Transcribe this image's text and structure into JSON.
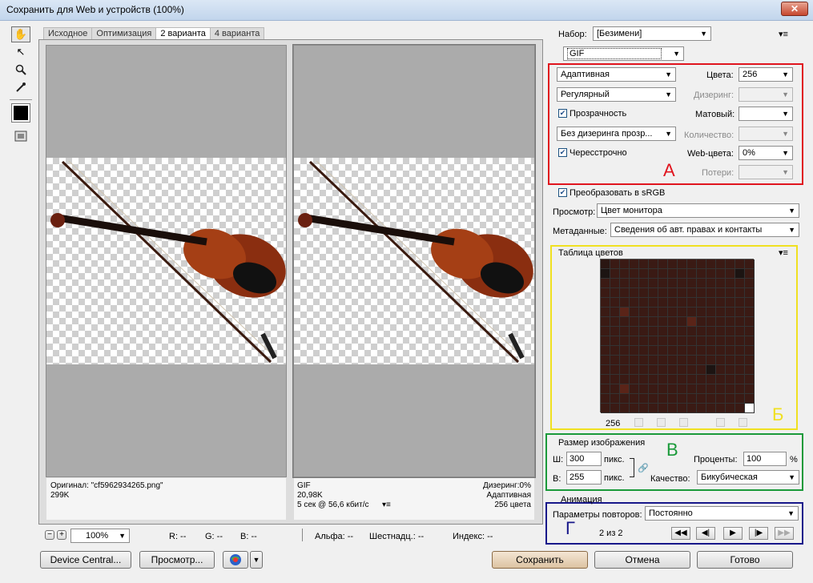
{
  "window": {
    "title": "Сохранить для Web и устройств (100%)",
    "close_label": "✕"
  },
  "tools": [
    {
      "name": "hand-tool",
      "glyph": "✋"
    },
    {
      "name": "slice-select-tool",
      "glyph": "↖"
    },
    {
      "name": "zoom-tool",
      "glyph": "🔍"
    },
    {
      "name": "eyedropper-tool",
      "glyph": "✎"
    }
  ],
  "tabs": [
    "Исходное",
    "Оптимизация",
    "2 варианта",
    "4 варианта"
  ],
  "active_tab": "2 варианта",
  "preview_left": {
    "line1": "Оригинал: \"cf5962934265.png\"",
    "line2": "299K"
  },
  "preview_right": {
    "format": "GIF",
    "size": "20,98K",
    "time": "5 сек @ 56,6 кбит/с",
    "dither": "Дизеринг:0%",
    "palette": "Адаптивная",
    "colors": "256 цвета"
  },
  "statusbar": {
    "zoom": "100%",
    "r": "R: --",
    "g": "G: --",
    "b": "B: --",
    "alpha": "Альфа: --",
    "hex": "Шестнадц.: --",
    "index": "Индекс: --"
  },
  "buttons": {
    "device_central": "Device Central...",
    "preview": "Просмотр...",
    "save": "Сохранить",
    "cancel": "Отмена",
    "done": "Готово"
  },
  "settings": {
    "preset_label": "Набор:",
    "preset_value": "[Безимени]",
    "format": "GIF",
    "reduction": "Адаптивная",
    "colors_label": "Цвета:",
    "colors_value": "256",
    "dither_algo": "Регулярный",
    "dither_label": "Дизеринг:",
    "transparency_label": "Прозрачность",
    "matte_label": "Матовый:",
    "trans_dither": "Без дизеринга прозр...",
    "amount_label": "Количество:",
    "interlaced_label": "Чересстрочно",
    "web_snap_label": "Web-цвета:",
    "web_snap_value": "0%",
    "lossy_label": "Потери:",
    "letter_a": "А",
    "convert_srgb_label": "Преобразовать в sRGB",
    "preview_label": "Просмотр:",
    "preview_value": "Цвет монитора",
    "metadata_label": "Метаданные:",
    "metadata_value": "Сведения об авт. правах и контакты"
  },
  "color_table": {
    "title": "Таблица цветов",
    "count": "256",
    "letter": "Б",
    "colors": [
      "#3a1a14",
      "#6b2a1a",
      "#8a3b22",
      "#b5492a",
      "#2a1612",
      "#4a221a",
      "#c0502c",
      "#7a2e1e",
      "#1c1412",
      "#5a2418",
      "#9a4026",
      "#d4602e",
      "#3e1c16",
      "#6a3222",
      "#e8e4e0",
      "#2e1a16"
    ]
  },
  "image_size": {
    "title": "Размер изображения",
    "letter": "В",
    "w_label": "Ш:",
    "w_value": "300",
    "h_label": "В:",
    "h_value": "255",
    "unit": "пикс.",
    "percent_label": "Проценты:",
    "percent_value": "100",
    "percent_sign": "%",
    "quality_label": "Качество:",
    "quality_value": "Бикубическая"
  },
  "animation": {
    "title": "Анимация",
    "letter": "Г",
    "loop_label": "Параметры повторов:",
    "loop_value": "Постоянно",
    "frame": "2 из 2"
  },
  "highlight_colors": {
    "a": "#e0141e",
    "b": "#f0e020",
    "c": "#1a9a3a",
    "d": "#18188a"
  }
}
